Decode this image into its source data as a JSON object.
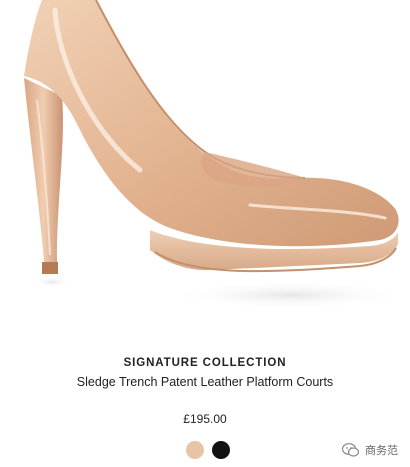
{
  "product": {
    "image_alt": "Nude patent leather platform court shoe",
    "collection": "SIGNATURE COLLECTION",
    "name": "Sledge Trench Patent Leather Platform Courts",
    "price": "£195.00",
    "swatches": [
      {
        "color": "#e8c4a4",
        "label": "nude"
      },
      {
        "color": "#111111",
        "label": "black"
      }
    ]
  },
  "watermark": {
    "text": "商务范",
    "icon": "wechat-icon"
  }
}
